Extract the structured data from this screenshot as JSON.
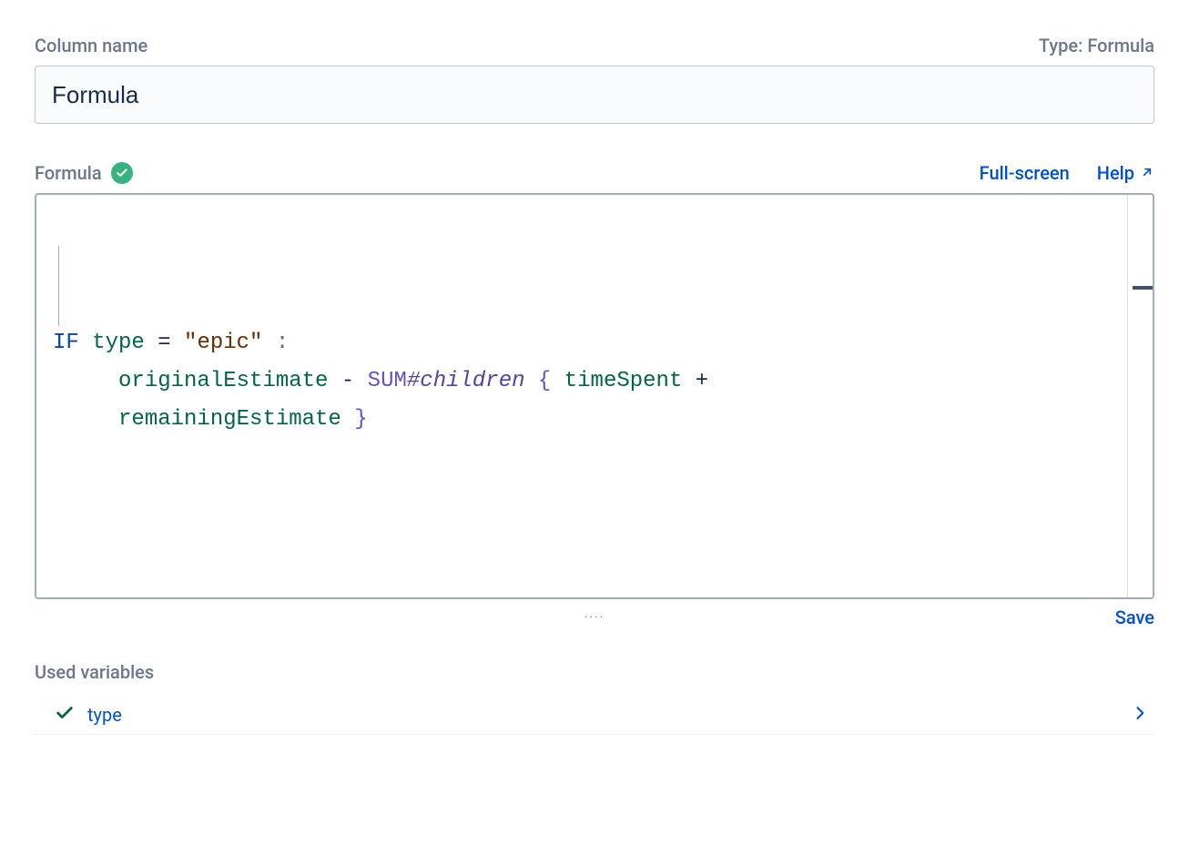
{
  "header": {
    "column_name_label": "Column name",
    "type_label": "Type: Formula"
  },
  "name_input": {
    "value": "Formula"
  },
  "formula_section": {
    "label": "Formula",
    "valid": true,
    "fullscreen_label": "Full-screen",
    "help_label": "Help"
  },
  "formula_tokens": [
    [
      {
        "t": "keyword",
        "v": "IF"
      },
      {
        "t": "sp",
        "v": " "
      },
      {
        "t": "var",
        "v": "type"
      },
      {
        "t": "sp",
        "v": " "
      },
      {
        "t": "op",
        "v": "="
      },
      {
        "t": "sp",
        "v": " "
      },
      {
        "t": "str",
        "v": "\"epic\""
      },
      {
        "t": "sp",
        "v": " "
      },
      {
        "t": "punct",
        "v": ":"
      }
    ],
    [
      {
        "t": "sp",
        "v": "     "
      },
      {
        "t": "var",
        "v": "originalEstimate"
      },
      {
        "t": "sp",
        "v": " "
      },
      {
        "t": "op",
        "v": "-"
      },
      {
        "t": "sp",
        "v": " "
      },
      {
        "t": "func",
        "v": "SUM"
      },
      {
        "t": "mod",
        "v": "#children"
      },
      {
        "t": "sp",
        "v": " "
      },
      {
        "t": "punct",
        "v": "{"
      },
      {
        "t": "sp",
        "v": " "
      },
      {
        "t": "var",
        "v": "timeSpent"
      },
      {
        "t": "sp",
        "v": " "
      },
      {
        "t": "op",
        "v": "+"
      }
    ],
    [
      {
        "t": "sp",
        "v": "     "
      },
      {
        "t": "var",
        "v": "remainingEstimate"
      },
      {
        "t": "sp",
        "v": " "
      },
      {
        "t": "punct",
        "v": "}"
      }
    ]
  ],
  "below": {
    "drag_handle": "····",
    "save_label": "Save"
  },
  "used_vars": {
    "label": "Used variables",
    "items": [
      {
        "name": "type"
      }
    ]
  }
}
